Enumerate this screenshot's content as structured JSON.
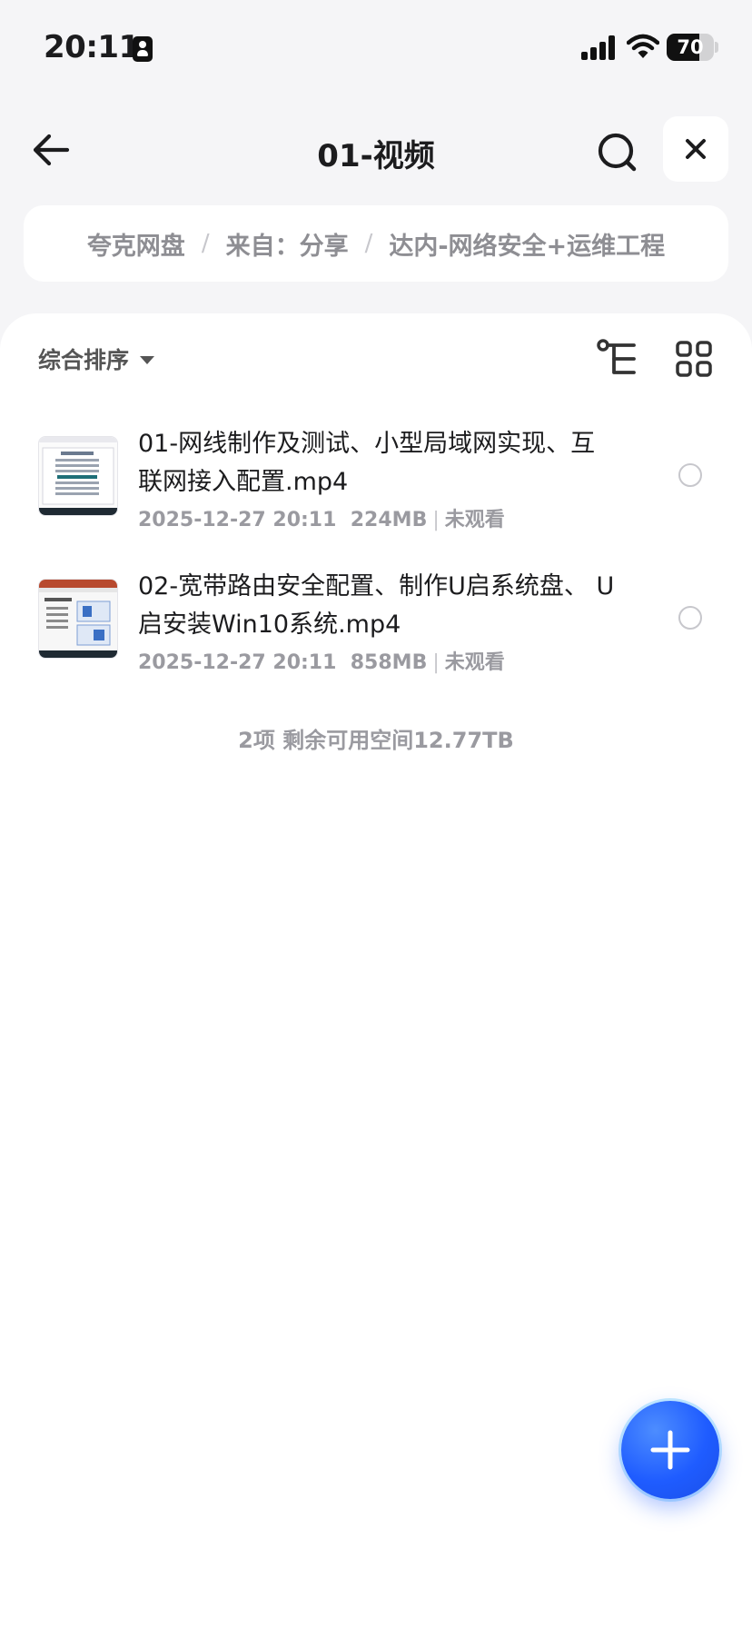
{
  "status_bar": {
    "time": "20:11",
    "battery": "70",
    "battery_fraction": 0.7
  },
  "header": {
    "title": "01-视频"
  },
  "breadcrumb": [
    {
      "label": "夸克网盘"
    },
    {
      "label": "来自：分享"
    },
    {
      "label": "达内-网络安全+运维工程"
    }
  ],
  "toolbar": {
    "sort_label": "综合排序"
  },
  "files": [
    {
      "name": "01-网线制作及测试、小型局域网实现、互联网接入配置.mp4",
      "date": "2025-12-27 20:11",
      "size": "224MB",
      "status": "未观看"
    },
    {
      "name": "02-宽带路由安全配置、制作U启系统盘、 U启安装Win10系统.mp4",
      "date": "2025-12-27 20:11",
      "size": "858MB",
      "status": "未观看"
    }
  ],
  "summary": "2项 剩余可用空间12.77TB",
  "colors": {
    "accent": "#1f5cff",
    "background": "#f5f5f7",
    "muted_text": "#9a9aa0"
  },
  "icons": {
    "back": "arrow-left-icon",
    "search": "search-icon",
    "close": "close-icon",
    "sort": "caret-down-icon",
    "tree": "tree-view-icon",
    "grid": "grid-view-icon",
    "fab": "plus-icon"
  }
}
